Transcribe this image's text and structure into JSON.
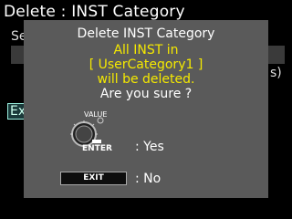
{
  "screen": {
    "title": "Delete : INST Category",
    "background_label_fragment": "Se",
    "background_paren_fragment": "s)",
    "background_button_fragment": "Ex"
  },
  "dialog": {
    "title": "Delete INST Category",
    "warning_line1": "All INST in",
    "warning_line2": "[ UserCategory1 ]",
    "warning_line3": "will be deleted.",
    "confirm_text": "Are you sure ?",
    "knob_label": "VALUE",
    "enter_label": "ENTER",
    "yes_label": ": Yes",
    "exit_button_label": "EXIT",
    "no_label": ": No"
  },
  "colors": {
    "background": "#000000",
    "dialog": "#5a5a5a",
    "warning_text": "#f5e900",
    "text": "#ffffff"
  },
  "icons": {
    "knob": "value-knob-icon",
    "enter": "enter-icon"
  }
}
